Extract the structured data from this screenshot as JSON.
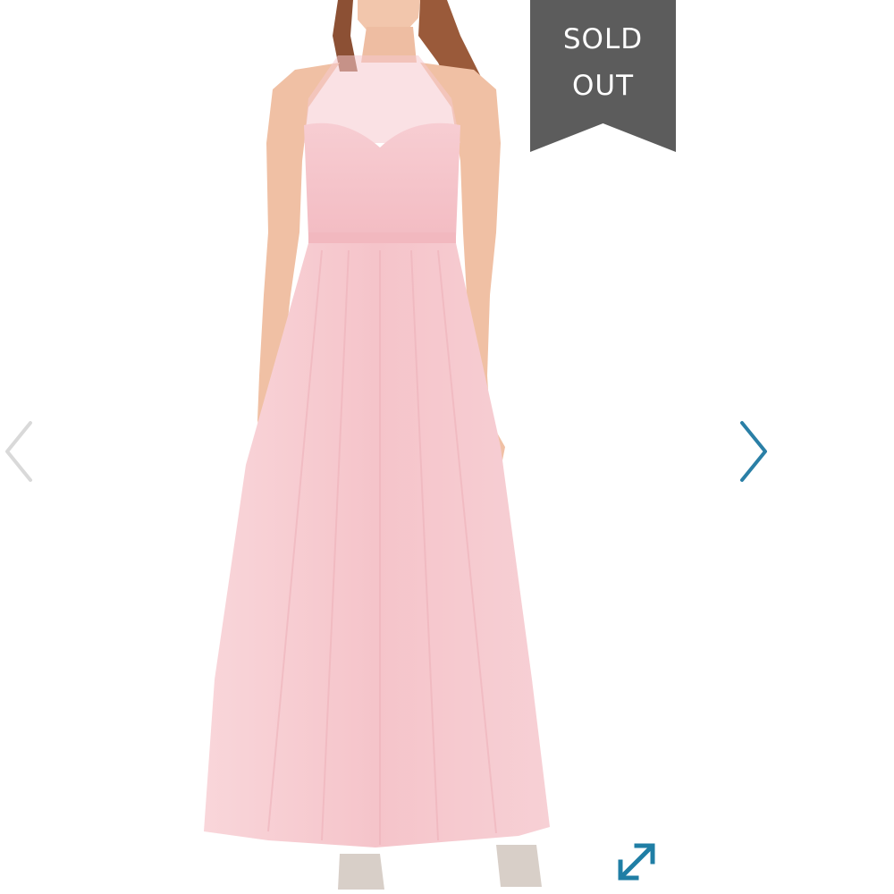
{
  "product": {
    "image_description_icon": "dress-photo",
    "dress_color": "#f6c8cd",
    "skin_color": "#f0c2a8",
    "hair_color": "#9a5a3a"
  },
  "badge": {
    "line1": "SOLD",
    "line2": "OUT",
    "color": "#5c5c5c"
  },
  "navigation": {
    "prev_icon": "chevron-left-icon",
    "next_icon": "chevron-right-icon",
    "prev_color": "#d9d9d9",
    "next_color": "#2a7fa6"
  },
  "expand": {
    "icon": "expand-arrows-icon",
    "color": "#1f7ea5"
  }
}
